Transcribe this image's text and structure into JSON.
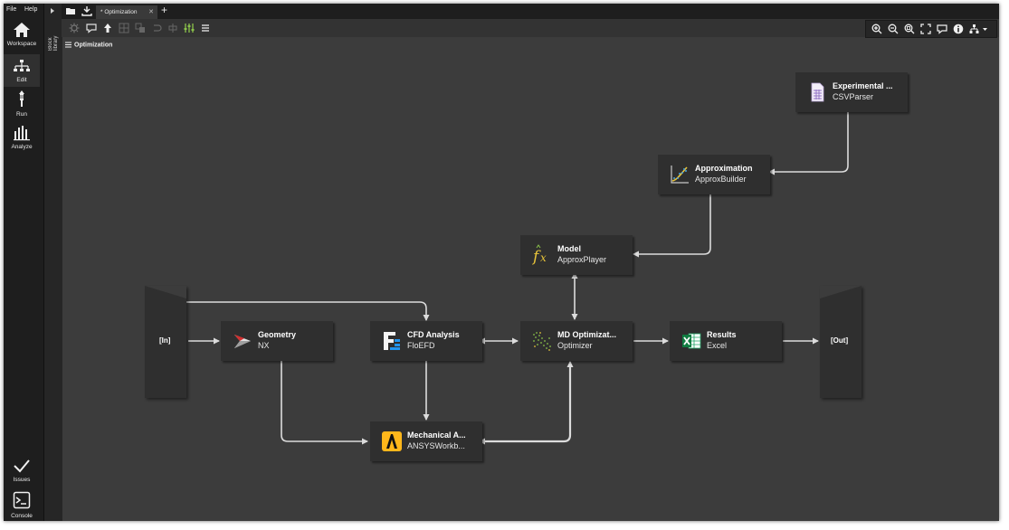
{
  "menu": {
    "file": "File",
    "help": "Help"
  },
  "nav": [
    {
      "label": "Workspace",
      "icon": "home-icon"
    },
    {
      "label": "Edit",
      "icon": "workflow-icon"
    },
    {
      "label": "Run",
      "icon": "run-icon"
    },
    {
      "label": "Analyze",
      "icon": "bar-chart-icon"
    }
  ],
  "nav_bottom": [
    {
      "label": "Issues",
      "icon": "checkmark-icon"
    },
    {
      "label": "Console",
      "icon": "console-icon"
    }
  ],
  "block_library": {
    "label": "Block library"
  },
  "tabs": [
    {
      "label": "* Optimization"
    }
  ],
  "breadcrumb": {
    "label": "Optimization"
  },
  "ports": {
    "in": "[In]",
    "out": "[Out]"
  },
  "blocks": {
    "experimental": {
      "title": "Experimental ...",
      "subtitle": "CSVParser",
      "icon": "csv-file-icon"
    },
    "approximation": {
      "title": "Approximation",
      "subtitle": "ApproxBuilder",
      "icon": "approximation-icon"
    },
    "model": {
      "title": "Model",
      "subtitle": "ApproxPlayer",
      "icon": "function-icon"
    },
    "geometry": {
      "title": "Geometry",
      "subtitle": "NX",
      "icon": "nx-icon"
    },
    "cfd": {
      "title": "CFD Analysis",
      "subtitle": "FloEFD",
      "icon": "floefd-icon"
    },
    "optimizer": {
      "title": "MD Optimizat...",
      "subtitle": "Optimizer",
      "icon": "scatter-dots-icon"
    },
    "results": {
      "title": "Results",
      "subtitle": "Excel",
      "icon": "excel-icon"
    },
    "mechanical": {
      "title": "Mechanical A...",
      "subtitle": "ANSYSWorkb...",
      "icon": "ansys-icon"
    }
  },
  "colors": {
    "background": "#3c3c3c",
    "block": "#2f2f2f",
    "sidebar": "#1e1e1e",
    "link": "#dcdcdc",
    "accent_green": "#8bc34a"
  }
}
